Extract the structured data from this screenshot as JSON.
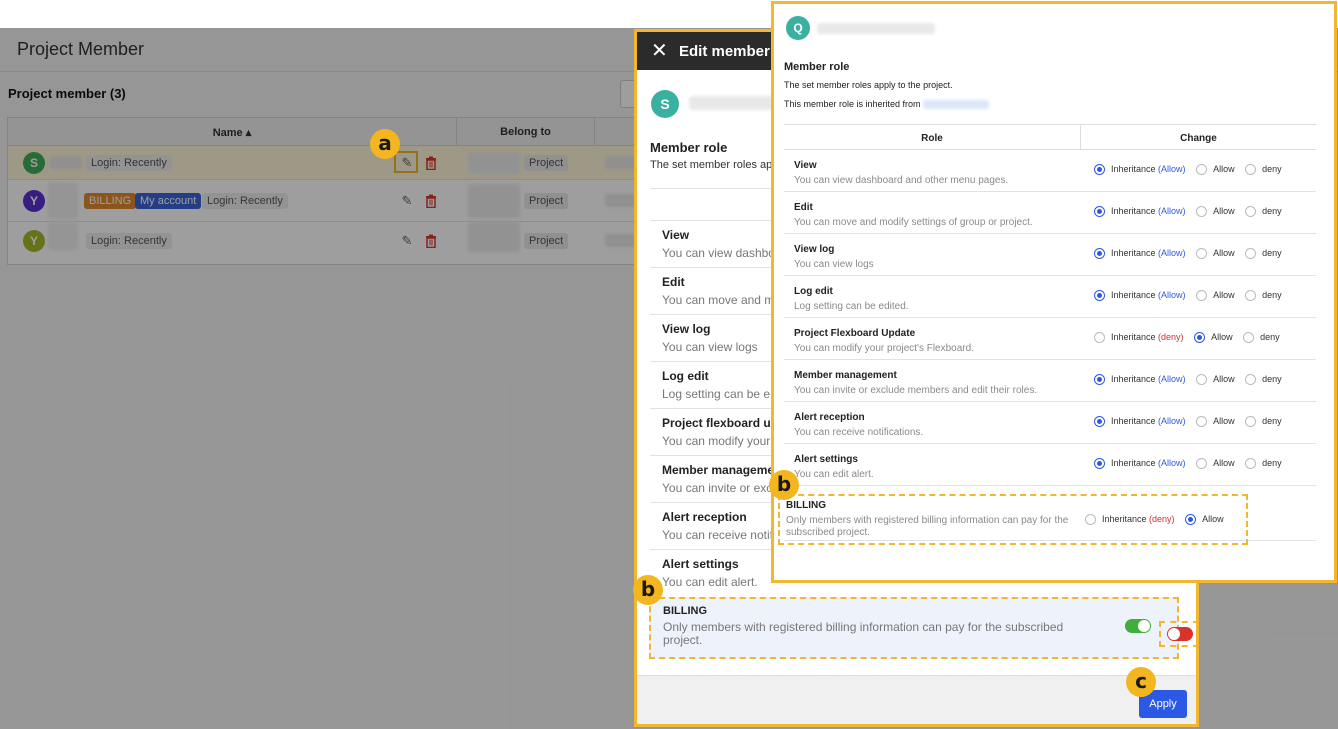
{
  "app": {
    "page_title": "Project Member",
    "section_title": "Project member (3)",
    "columns": {
      "name": "Name ▴",
      "belong_to": "Belong to"
    },
    "members": [
      {
        "avatar": "S",
        "avatar_color": "#3fae5a",
        "login": "Login: Recently",
        "project": "Project"
      },
      {
        "avatar": "Y",
        "avatar_color": "#5b2fd1",
        "badge_billing": "BILLING",
        "badge_myaccount": "My account",
        "login": "Login: Recently",
        "project": "Project"
      },
      {
        "avatar": "Y",
        "avatar_color": "#a9b92c",
        "login": "Login: Recently",
        "project": "Project"
      }
    ]
  },
  "drawer": {
    "title": "Edit member r",
    "avatar": "S",
    "member_role_title": "Member role",
    "member_role_desc": "The set member roles ap",
    "roles": [
      {
        "name": "View",
        "desc": "You can view dashbo"
      },
      {
        "name": "Edit",
        "desc": "You can move and m"
      },
      {
        "name": "View log",
        "desc": "You can view logs"
      },
      {
        "name": "Log edit",
        "desc": "Log setting can be e"
      },
      {
        "name": "Project flexboard up",
        "desc": "You can modify your"
      },
      {
        "name": "Member managemen",
        "desc": "You can invite or exc"
      },
      {
        "name": "Alert reception",
        "desc": "You can receive notif"
      },
      {
        "name": "Alert settings",
        "desc": "You can edit alert."
      }
    ],
    "billing": {
      "name": "BILLING",
      "desc": "Only members with registered billing information can pay for the subscribed project."
    },
    "apply_label": "Apply"
  },
  "inset": {
    "avatar": "Q",
    "member_role_title": "Member role",
    "desc1": "The set member roles apply to the project.",
    "desc2": "This member role is inherited from",
    "col_role": "Role",
    "col_change": "Change",
    "opt_inheritance": "Inheritance",
    "opt_allow": "Allow",
    "opt_deny": "deny",
    "roles": [
      {
        "name": "View",
        "desc": "You can view dashboard and other menu pages.",
        "inherit": "(Allow)"
      },
      {
        "name": "Edit",
        "desc": "You can move and modify settings of group or project.",
        "inherit": "(Allow)"
      },
      {
        "name": "View log",
        "desc": "You can view logs",
        "inherit": "(Allow)"
      },
      {
        "name": "Log edit",
        "desc": "Log setting can be edited.",
        "inherit": "(Allow)"
      },
      {
        "name": "Project Flexboard Update",
        "desc": "You can modify your project's Flexboard.",
        "inherit": "(deny)"
      },
      {
        "name": "Member management",
        "desc": "You can invite or exclude members and edit their roles.",
        "inherit": "(Allow)"
      },
      {
        "name": "Alert reception",
        "desc": "You can receive notifications.",
        "inherit": "(Allow)"
      },
      {
        "name": "Alert settings",
        "desc": "You can edit alert.",
        "inherit": "(Allow)"
      }
    ],
    "billing": {
      "name": "BILLING",
      "desc": "Only members with registered billing information can pay for the subscribed project.",
      "inherit": "(deny)"
    }
  },
  "callouts": {
    "a": "a",
    "b": "b",
    "c": "c"
  },
  "colors": {
    "accent": "#f0b72f",
    "primary": "#2b59e5",
    "toggle_on": "#3fae3a",
    "toggle_off": "#d9342b"
  }
}
